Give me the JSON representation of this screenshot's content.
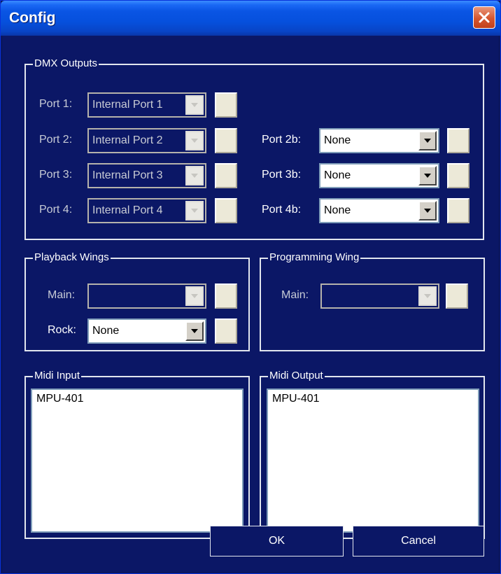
{
  "window": {
    "title": "Config"
  },
  "dmx": {
    "group_title": "DMX Outputs",
    "left_ports": [
      {
        "label": "Port 1:",
        "value": "Internal Port 1"
      },
      {
        "label": "Port 2:",
        "value": "Internal Port 2"
      },
      {
        "label": "Port 3:",
        "value": "Internal Port 3"
      },
      {
        "label": "Port 4:",
        "value": "Internal Port 4"
      }
    ],
    "right_ports": [
      {
        "label": "Port 2b:",
        "value": "None"
      },
      {
        "label": "Port 3b:",
        "value": "None"
      },
      {
        "label": "Port 4b:",
        "value": "None"
      }
    ]
  },
  "playback": {
    "group_title": "Playback Wings",
    "main_label": "Main:",
    "main_value": "",
    "rock_label": "Rock:",
    "rock_value": "None"
  },
  "programming": {
    "group_title": "Programming Wing",
    "main_label": "Main:",
    "main_value": ""
  },
  "midi_in": {
    "group_title": "Midi Input",
    "items": [
      "MPU-401"
    ]
  },
  "midi_out": {
    "group_title": "Midi Output",
    "items": [
      "MPU-401"
    ]
  },
  "buttons": {
    "ok": "OK",
    "cancel": "Cancel"
  }
}
